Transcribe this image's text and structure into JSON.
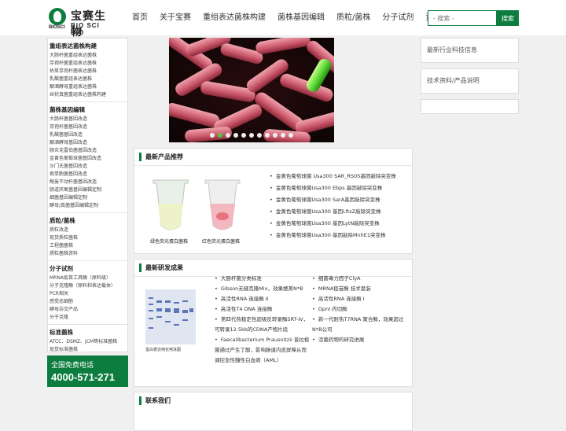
{
  "header": {
    "logo_cn": "宝赛生物",
    "logo_en": "BIO SCI BIO",
    "logo_en_left": "BIOSCI",
    "nav": [
      "首页",
      "关于宝赛",
      "重组表达菌株构建",
      "菌株基因编辑",
      "质粒/菌株",
      "分子试剂",
      "资料中心"
    ],
    "search_placeholder": "- 搜索 -",
    "search_button": "搜索"
  },
  "sidebar": {
    "groups": [
      {
        "title": "重组表达菌株构建",
        "links": [
          "大肠杆菌重组表达菌株",
          "芽孢杆菌重组表达菌株",
          "枯草芽孢杆菌表达菌株",
          "乳酸菌重组表达菌株",
          "酿酒酵母重组表达菌株",
          "丝状真菌重组表达菌株构建"
        ]
      },
      {
        "title": "菌株基因编辑",
        "links": [
          "大肠杆菌基因改造",
          "芽孢杆菌基因改造",
          "乳酸菌基因改造",
          "酿酒酵母基因改造",
          "肠炎克雷伯菌基因改造",
          "金黄色葡萄球菌基因改造",
          "沙门氏菌基因改造",
          "假单胞菌基因改造",
          "鲍曼不动杆菌基因改造",
          "肠道厌氧菌基因编辑定制",
          "细菌基因编辑定制",
          "酵母/真菌基因编辑定制"
        ]
      },
      {
        "title": "质粒/菌株",
        "links": [
          "质粒改造",
          "现货质粒菌株",
          "工程菌菌株",
          "质粒菌株资料"
        ]
      },
      {
        "title": "分子试剂",
        "links": [
          "MRNA疫苗工具酶（原料级）",
          "分子克隆酶（原料和表达载体）",
          "PCR相关",
          "感受态细胞",
          "酵母杂交产品",
          "分子克隆"
        ]
      },
      {
        "title": "标准菌株",
        "links": [
          "ATCC、DSMZ、JCM等标准菌株",
          "现货标准菌株"
        ]
      }
    ],
    "phone_label": "全国免费电话",
    "phone_number": "4000-571-271"
  },
  "banner": {
    "slide_count": 11,
    "active_index": 1
  },
  "products": {
    "title": "最新产品推荐",
    "image_caption_left": "绿色荧光蛋白菌株",
    "image_caption_right": "红色荧光蛋白菌株",
    "items": [
      "金黄色葡萄球菌 Usa300 SAR_RS05基因敲除突变株",
      "金黄色葡萄球菌Usa300 Ebps 基因敲除突变株",
      "金黄色葡萄球菌Usa300 SarA基因敲除突变株",
      "金黄色葡萄球菌Usa300 基因LftsZ敲除突变株",
      "金黄色葡萄球菌Usa300 基因LytN敲除突变株",
      "金黄色葡萄球菌Usa300 基因敲除MnhE1突变株"
    ]
  },
  "research": {
    "title": "最新研发成果",
    "image_caption": "蛋白表达纯化电泳图",
    "col1": [
      "大肠杆菌分类标准",
      "Gibson无缝克隆Mix，效果媲美N*B",
      "高活性RNA 连接酶 II",
      "高活性T4 DNA 连接酶",
      "第四代热稳定性超级反转录酶SRT-IV，可转录12.5kb的CDNA产物片段",
      "Faecalibacterium Prausnitzii 普拉梭菌通过产生丁酸，影响肠道内皮屏障从而调控急性髓性白血病（AML）"
    ],
    "col2": [
      "细菌毒力因子ClyA",
      "MRNA疫苗酶 技术套装",
      "高活性RNA 连接酶 I",
      "DpnI 内切酶",
      "新一代耐热T7RNA 聚合酶，效果超过N*B公司",
      "活菌药物的研究进展"
    ]
  },
  "contact": {
    "title": "联系我们"
  },
  "right": {
    "news": "最新行业科技信息",
    "docs": "技术资料/产品说明"
  },
  "colors": {
    "brand_green": "#0d7d3f",
    "active_dot": "#4ec93e"
  }
}
